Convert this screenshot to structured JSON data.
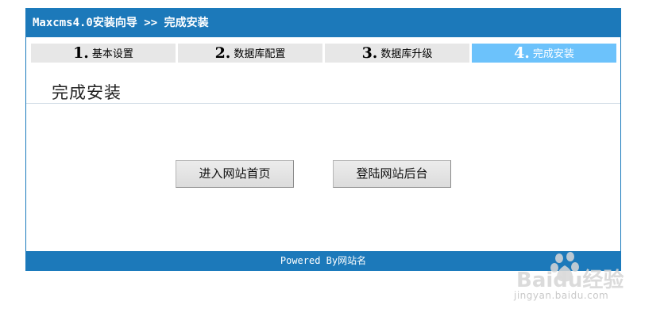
{
  "header": {
    "title": "Maxcms4.0安装向导 >> 完成安装"
  },
  "steps": [
    {
      "num": "1.",
      "label": "基本设置",
      "active": false
    },
    {
      "num": "2.",
      "label": "数据库配置",
      "active": false
    },
    {
      "num": "3.",
      "label": "数据库升级",
      "active": false
    },
    {
      "num": "4.",
      "label": "完成安装",
      "active": true
    }
  ],
  "main": {
    "title": "完成安装",
    "buttons": {
      "home": "进入网站首页",
      "admin": "登陆网站后台"
    }
  },
  "footer": {
    "text": "Powered By网站名"
  },
  "watermark": {
    "brand": "Baidu经验",
    "url": "jingyan.baidu.com"
  },
  "colors": {
    "bar": "#1c79ba",
    "active_step": "#6cc2fb",
    "step_bg": "#e7e7e7"
  }
}
